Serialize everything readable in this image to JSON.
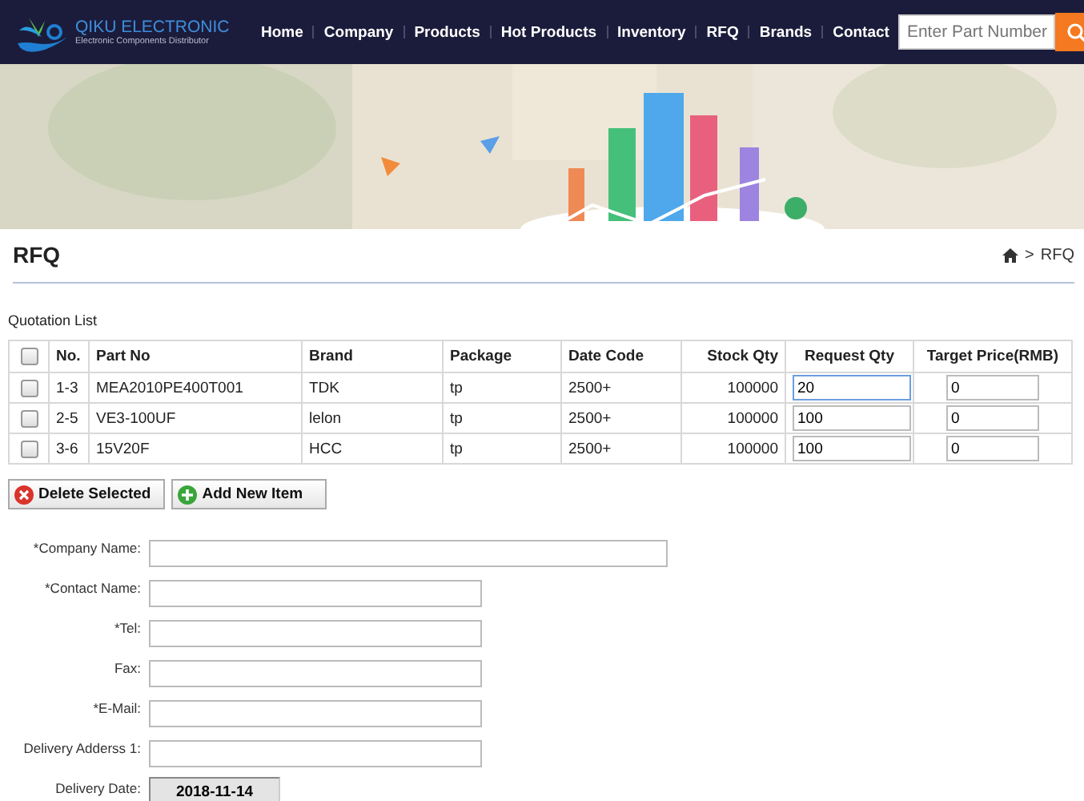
{
  "header": {
    "logo_title": "QIKU ELECTRONIC",
    "logo_subtitle": "Electronic Components Distributor",
    "nav": [
      {
        "label": "Home"
      },
      {
        "label": "Company"
      },
      {
        "label": "Products"
      },
      {
        "label": "Hot Products"
      },
      {
        "label": "Inventory"
      },
      {
        "label": "RFQ"
      },
      {
        "label": "Brands"
      },
      {
        "label": "Contact"
      }
    ],
    "search": {
      "placeholder": "Enter Part Number"
    }
  },
  "page": {
    "title": "RFQ",
    "breadcrumb": [
      {
        "separator": ">",
        "label": "RFQ"
      }
    ]
  },
  "quotation": {
    "caption": "Quotation List",
    "columns": [
      {
        "label": "No."
      },
      {
        "label": "Part No"
      },
      {
        "label": "Brand"
      },
      {
        "label": "Package"
      },
      {
        "label": "Date Code"
      },
      {
        "label": "Stock Qty"
      },
      {
        "label": "Request Qty"
      },
      {
        "label": "Target Price(RMB)"
      }
    ],
    "header_checked": false,
    "rows": [
      {
        "checked": false,
        "no": "1-3",
        "part_no": "MEA2010PE400T001",
        "brand": "TDK",
        "package": "tp",
        "date_code": "2500+",
        "stock_qty": "100000",
        "request_qty": "20",
        "request_focused": true,
        "target_price": "0"
      },
      {
        "checked": false,
        "no": "2-5",
        "part_no": "VE3-100UF",
        "brand": "lelon",
        "package": "tp",
        "date_code": "2500+",
        "stock_qty": "100000",
        "request_qty": "100",
        "request_focused": false,
        "target_price": "0"
      },
      {
        "checked": false,
        "no": "3-6",
        "part_no": "15V20F",
        "brand": "HCC",
        "package": "tp",
        "date_code": "2500+",
        "stock_qty": "100000",
        "request_qty": "100",
        "request_focused": false,
        "target_price": "0"
      }
    ],
    "buttons": [
      {
        "label": "Delete Selected",
        "kind": "delete"
      },
      {
        "label": "Add New Item",
        "kind": "add"
      }
    ]
  },
  "form": {
    "fields": [
      {
        "label": "*Company Name:",
        "kind": "wide"
      },
      {
        "label": "*Contact Name:",
        "kind": "text"
      },
      {
        "label": "*Tel:",
        "kind": "text"
      },
      {
        "label": "Fax:",
        "kind": "text"
      },
      {
        "label": "*E-Mail:",
        "kind": "text"
      },
      {
        "label": "Delivery Adderss 1:",
        "kind": "text"
      },
      {
        "label": "Delivery Date:",
        "kind": "date",
        "value": "2018-11-14"
      }
    ]
  }
}
